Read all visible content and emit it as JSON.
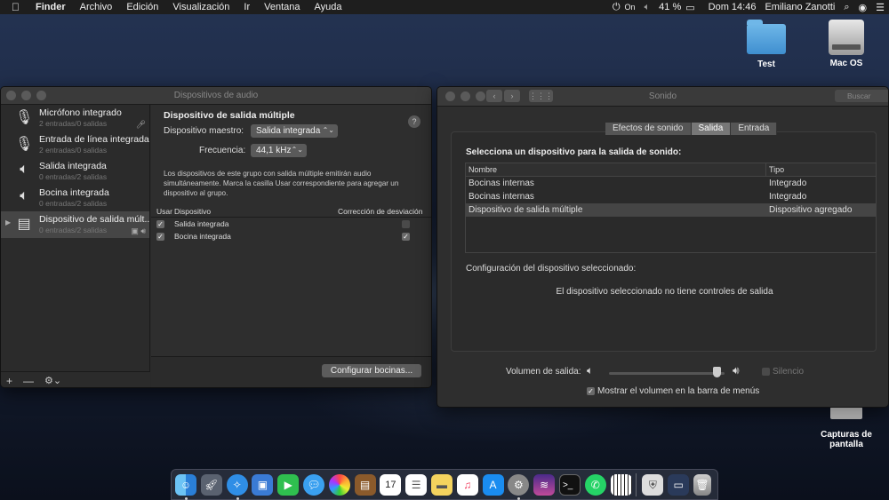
{
  "menubar": {
    "apple_icon": "apple-icon",
    "app": "Finder",
    "items": [
      "Archivo",
      "Edición",
      "Visualización",
      "Ir",
      "Ventana",
      "Ayuda"
    ],
    "on": "On",
    "battery": "41 %",
    "datetime": "Dom 14:46",
    "user": "Emiliano Zanotti"
  },
  "desktop": {
    "icons": [
      {
        "label": "Test",
        "icon": "folder-icon"
      },
      {
        "label": "Mac OS",
        "icon": "hard-drive-icon"
      },
      {
        "label": "Capturas de pantalla",
        "icon": "screenshots-folder-icon"
      }
    ]
  },
  "audio": {
    "title": "Dispositivos de audio",
    "devices": [
      {
        "name": "Micrófono integrado",
        "sub": "2 entradas/0 salidas",
        "icon": "microphone-icon"
      },
      {
        "name": "Entrada de línea integrada",
        "sub": "2 entradas/0 salidas",
        "icon": "line-in-icon"
      },
      {
        "name": "Salida integrada",
        "sub": "0 entradas/2 salidas",
        "icon": "speaker-icon"
      },
      {
        "name": "Bocina integrada",
        "sub": "0 entradas/2 salidas",
        "icon": "speaker-icon"
      },
      {
        "name": "Dispositivo de salida múlt...",
        "sub": "0 entradas/2 salidas",
        "icon": "multi-output-icon"
      }
    ],
    "heading": "Dispositivo de salida múltiple",
    "master_label": "Dispositivo maestro:",
    "master_value": "Salida integrada",
    "freq_label": "Frecuencia:",
    "freq_value": "44,1 kHz",
    "description": "Los dispositivos de este grupo con salida múltiple emitirán audio simultáneamente. Marca la casilla Usar correspondiente para agregar un dispositivo al grupo.",
    "table": {
      "headers": [
        "Usar",
        "Dispositivo",
        "Corrección de desviación"
      ],
      "rows": [
        {
          "use": true,
          "device": "Salida integrada",
          "drift": false
        },
        {
          "use": true,
          "device": "Bocina integrada",
          "drift": true
        }
      ]
    },
    "configure_button": "Configurar bocinas...",
    "footer": {
      "add": "+",
      "remove": "—",
      "gear": "⚙︎⌄"
    }
  },
  "sound": {
    "title": "Sonido",
    "search_placeholder": "Buscar",
    "tabs": [
      "Efectos de sonido",
      "Salida",
      "Entrada"
    ],
    "active_tab": "Salida",
    "heading": "Selecciona un dispositivo para la salida de sonido:",
    "table": {
      "headers": [
        "Nombre",
        "Tipo"
      ],
      "rows": [
        {
          "name": "Bocinas internas",
          "type": "Integrado"
        },
        {
          "name": "Bocinas internas",
          "type": "Integrado"
        },
        {
          "name": "Dispositivo de salida múltiple",
          "type": "Dispositivo agregado",
          "selected": true
        }
      ]
    },
    "config_label": "Configuración del dispositivo seleccionado:",
    "no_controls": "El dispositivo seleccionado no tiene controles de salida",
    "volume_label": "Volumen de salida:",
    "volume_level": 0.97,
    "mute_label": "Silencio",
    "show_volume_label": "Mostrar el volumen en la barra de menús",
    "show_volume_checked": true
  },
  "dock": {
    "apps": [
      "finder-icon",
      "launchpad-icon",
      "safari-icon",
      "preview-icon",
      "facetime-icon",
      "messages-icon",
      "photos-icon",
      "notes-icon",
      "calendar-icon",
      "reminders-icon",
      "stickies-icon",
      "music-icon",
      "app-store-icon",
      "system-preferences-icon",
      "siri-icon",
      "terminal-icon",
      "whatsapp-icon",
      "piano-icon",
      "security-icon",
      "screen-icon",
      "trash-icon"
    ],
    "calendar_day": "17"
  }
}
